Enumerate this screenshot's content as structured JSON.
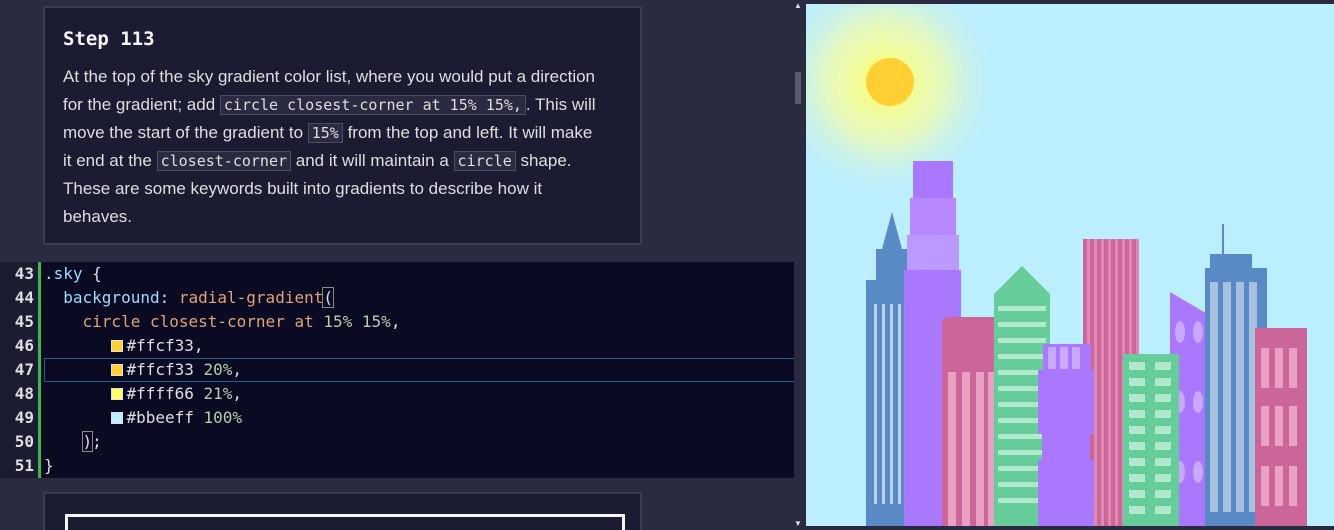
{
  "lesson": {
    "title": "Step 113",
    "text": [
      {
        "t": "At the top of the sky gradient color list, where you would put a direction for the gradient; add "
      },
      {
        "code": "circle closest-corner at 15% 15%,"
      },
      {
        "t": ". This will move the start of the gradient to "
      },
      {
        "code": "15%"
      },
      {
        "t": " from the top and left. It will make it end at the "
      },
      {
        "code": "closest-corner"
      },
      {
        "t": " and it will maintain a "
      },
      {
        "code": "circle"
      },
      {
        "t": " shape. These are some keywords built into gradients to describe how it behaves."
      }
    ]
  },
  "editor": {
    "lines": [
      {
        "n": "43",
        "tokens": [
          {
            "c": "k-sel",
            "t": ".sky"
          },
          {
            "c": "k-punc",
            "t": " {"
          }
        ]
      },
      {
        "n": "44",
        "tokens": [
          {
            "c": "k-prop",
            "t": "  background"
          },
          {
            "c": "k-punc",
            "t": ": "
          },
          {
            "c": "k-fn",
            "t": "radial-gradient"
          },
          {
            "c": "k-punc bracket",
            "t": "("
          }
        ]
      },
      {
        "n": "45",
        "tokens": [
          {
            "c": "k-kw",
            "t": "    circle closest-corner at "
          },
          {
            "c": "k-num",
            "t": "15%"
          },
          {
            "c": "k-punc",
            "t": " "
          },
          {
            "c": "k-num",
            "t": "15%"
          },
          {
            "c": "k-punc",
            "t": ","
          }
        ]
      },
      {
        "n": "46",
        "tokens": [
          {
            "c": "k-punc",
            "t": "       "
          },
          {
            "swatch": "#ffcf33"
          },
          {
            "c": "k-punc",
            "t": "#ffcf33,"
          }
        ]
      },
      {
        "n": "47",
        "active": true,
        "tokens": [
          {
            "c": "k-punc",
            "t": "       "
          },
          {
            "swatch": "#ffcf33"
          },
          {
            "c": "k-punc",
            "t": "#ffcf33 "
          },
          {
            "c": "k-num",
            "t": "20%"
          },
          {
            "c": "k-punc",
            "t": ","
          }
        ]
      },
      {
        "n": "48",
        "tokens": [
          {
            "c": "k-punc",
            "t": "       "
          },
          {
            "swatch": "#ffff66"
          },
          {
            "c": "k-punc",
            "t": "#ffff66 "
          },
          {
            "c": "k-num",
            "t": "21%"
          },
          {
            "c": "k-punc",
            "t": ","
          }
        ]
      },
      {
        "n": "49",
        "tokens": [
          {
            "c": "k-punc",
            "t": "       "
          },
          {
            "swatch": "#bbeeff"
          },
          {
            "c": "k-punc",
            "t": "#bbeeff "
          },
          {
            "c": "k-num",
            "t": "100%"
          }
        ]
      },
      {
        "n": "50",
        "tokens": [
          {
            "c": "k-punc",
            "t": "    "
          },
          {
            "c": "k-punc bracket",
            "t": ")"
          },
          {
            "c": "k-punc",
            "t": ";"
          }
        ]
      },
      {
        "n": "51",
        "tokens": [
          {
            "c": "k-punc",
            "t": "}"
          }
        ]
      }
    ]
  },
  "colors": {
    "sky": "#bbeeff",
    "sun": "#ffcf33",
    "glow": "#ffff66",
    "blue": "#5a8ac6",
    "purple": "#aa77ff",
    "pink": "#cc6699",
    "green": "#66cc99"
  }
}
